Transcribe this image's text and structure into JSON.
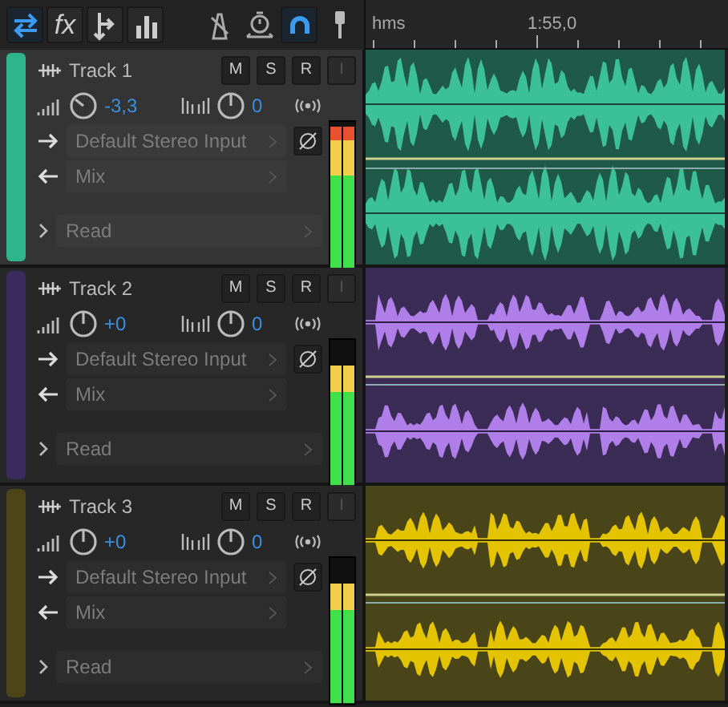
{
  "toolbar": {
    "left": [
      {
        "kind": "swap",
        "selected": true
      },
      {
        "kind": "fx",
        "label": "fx",
        "selected": false
      },
      {
        "kind": "send",
        "selected": false
      },
      {
        "kind": "eq",
        "selected": false
      }
    ],
    "right": [
      {
        "kind": "metronome",
        "selected": false
      },
      {
        "kind": "stopwatch",
        "selected": false
      },
      {
        "kind": "magnet",
        "selected": true
      },
      {
        "kind": "mic",
        "selected": false
      }
    ]
  },
  "ruler": {
    "unit": "hms",
    "label": "1:55,0"
  },
  "tracks": [
    {
      "name": "Track 1",
      "color": "#2fb58a",
      "selected": true,
      "volume": "-3,3",
      "pan": "0",
      "input": "Default Stereo Input",
      "output": "Mix",
      "automation": "Read",
      "buttons": [
        "M",
        "S",
        "R",
        "I"
      ],
      "level": 0.97
    },
    {
      "name": "Track 2",
      "color": "#3b2b5c",
      "selected": false,
      "volume": "+0",
      "pan": "0",
      "input": "Default Stereo Input",
      "output": "Mix",
      "automation": "Read",
      "buttons": [
        "M",
        "S",
        "R",
        "I"
      ],
      "level": 0.82
    },
    {
      "name": "Track 3",
      "color": "#4d4518",
      "selected": false,
      "volume": "+0",
      "pan": "0",
      "input": "Default Stereo Input",
      "output": "Mix",
      "automation": "Read",
      "buttons": [
        "M",
        "S",
        "R",
        "I"
      ],
      "level": 0.82
    }
  ]
}
